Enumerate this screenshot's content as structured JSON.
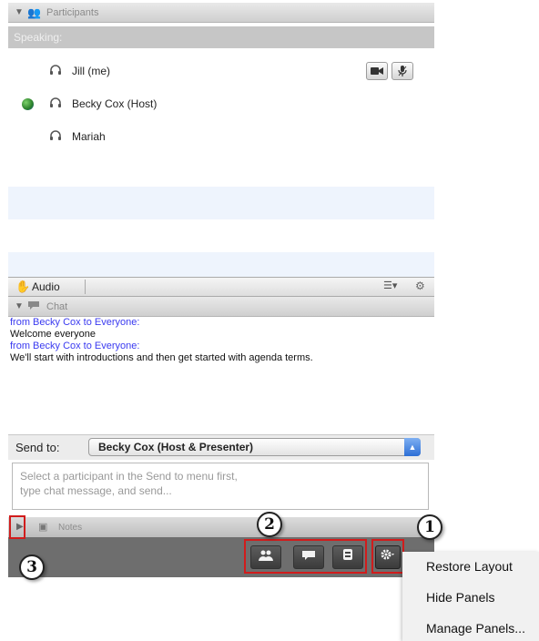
{
  "participants_panel": {
    "title": "Participants",
    "speaking_label": "Speaking:",
    "participants": [
      {
        "name": "Jill (me)",
        "status_indicator": false
      },
      {
        "name": "Becky Cox (Host)",
        "status_indicator": true
      },
      {
        "name": "Mariah",
        "status_indicator": false
      }
    ],
    "audio_label": "Audio"
  },
  "chat_panel": {
    "title": "Chat",
    "messages": [
      {
        "header": "from Becky Cox to Everyone:",
        "text": "Welcome everyone"
      },
      {
        "header": "from Becky Cox to Everyone:",
        "text": "We'll start with introductions and then get started with agenda terms."
      }
    ],
    "send_to_label": "Send to:",
    "send_to_value": "Becky Cox (Host & Presenter)",
    "message_placeholder_line1": "Select a participant in the Send to menu first,",
    "message_placeholder_line2": "type chat message, and send..."
  },
  "notes_panel": {
    "title": "Notes"
  },
  "panel_menu": {
    "items": [
      "Restore Layout",
      "Hide Panels",
      "Manage Panels..."
    ]
  },
  "annotations": [
    "1",
    "2",
    "3"
  ],
  "colors": {
    "annotation_red": "#d11c1c",
    "chat_header_blue": "#3a3af0",
    "bottom_bar": "#6e6e6e"
  },
  "icons": {
    "participants_header": "people-icon",
    "chat_header": "speech-bubble-icon",
    "notes_header": "notes-icon",
    "row_status": "headset-icon",
    "video": "video-camera-icon",
    "mic": "microphone-icon",
    "raise_hand": "hand-icon",
    "list_options": "list-menu-icon",
    "settings": "gear-icon"
  }
}
